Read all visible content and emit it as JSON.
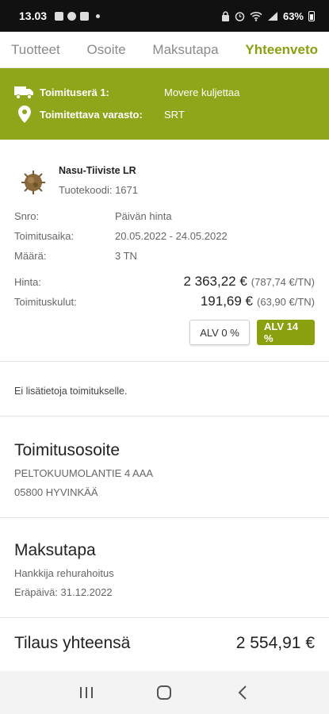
{
  "status_bar": {
    "time": "13.03",
    "battery": "63%"
  },
  "tabs": [
    {
      "label": "Tuotteet",
      "active": false
    },
    {
      "label": "Osoite",
      "active": false
    },
    {
      "label": "Maksutapa",
      "active": false
    },
    {
      "label": "Yhteenveto",
      "active": true
    }
  ],
  "banner": {
    "delivery_batch_label": "Toimituserä 1:",
    "delivery_batch_value": "Movere kuljettaa",
    "warehouse_label": "Toimitettava varasto:",
    "warehouse_value": "SRT"
  },
  "product": {
    "name": "Nasu-Tiiviste LR",
    "code_label": "Tuotekoodi:",
    "code": "1671",
    "snro_label": "Snro:",
    "snro_value": "Päivän hinta",
    "delivery_time_label": "Toimitusaika:",
    "delivery_time_value": "20.05.2022 - 24.05.2022",
    "quantity_label": "Määrä:",
    "quantity_value": "3 TN",
    "price_label": "Hinta:",
    "price_value": "2 363,22 €",
    "price_unit": "(787,74 €/TN)",
    "shipping_label": "Toimituskulut:",
    "shipping_value": "191,69 €",
    "shipping_unit": "(63,90 €/TN)",
    "alv0_label": "ALV 0 %",
    "alv14_label": "ALV 14 %"
  },
  "note": "Ei lisätietoja toimitukselle.",
  "delivery_address": {
    "title": "Toimitusosoite",
    "line1": "PELTOKUUMOLANTIE 4 AAA",
    "line2": "05800 HYVINKÄÄ"
  },
  "payment": {
    "title": "Maksutapa",
    "method": "Hankkija rehurahoitus",
    "due_date": "Eräpäivä: 31.12.2022"
  },
  "total": {
    "label": "Tilaus yhteensä",
    "value": "2 554,91 €"
  },
  "colors": {
    "accent": "#8aa00f",
    "banner": "#8fa61a"
  }
}
